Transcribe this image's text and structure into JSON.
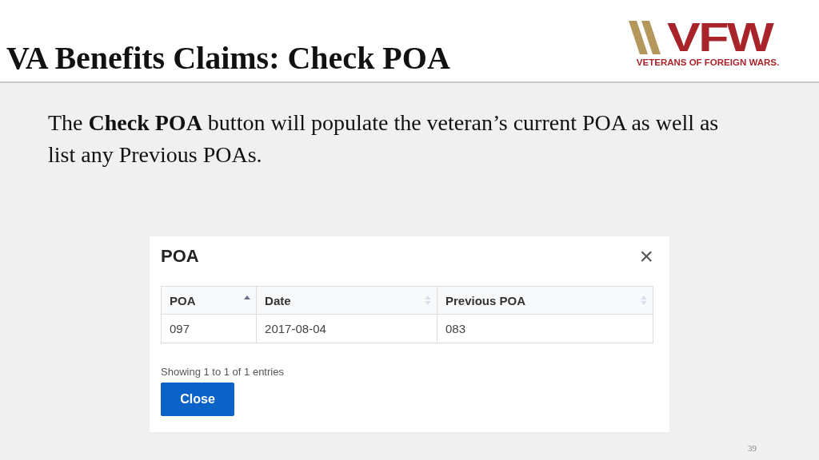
{
  "slide": {
    "title": "VA Benefits Claims: Check POA",
    "logo": {
      "mark": "VFW",
      "tagline": "VETERANS OF FOREIGN WARS."
    },
    "body": "The **Check POA** button will populate the veteran’s current POA as well as list any Previous POAs.",
    "page_number": "39"
  },
  "dialog": {
    "title": "POA",
    "close_icon": "×",
    "table": {
      "columns": [
        {
          "label": "POA",
          "sorted": true
        },
        {
          "label": "Date",
          "sorted": false
        },
        {
          "label": "Previous POA",
          "sorted": false
        }
      ],
      "rows": [
        [
          "097",
          "2017-08-04",
          "083"
        ]
      ]
    },
    "info": "Showing 1 to 1 of 1 entries",
    "button": "Close"
  }
}
